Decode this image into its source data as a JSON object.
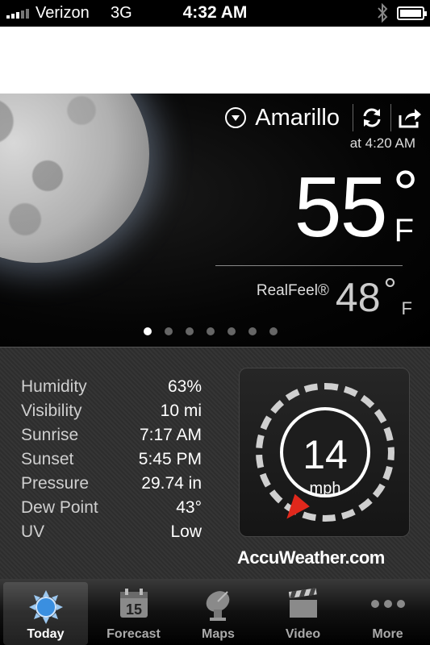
{
  "status_bar": {
    "carrier": "Verizon",
    "network": "3G",
    "time": "4:32 AM",
    "battery_level": 0.9
  },
  "current": {
    "city": "Amarillo",
    "observed_at": "at 4:20 AM",
    "temperature": "55",
    "temp_degree": "°",
    "temp_unit": "F",
    "realfeel_label": "RealFeel®",
    "realfeel_value": "48",
    "realfeel_degree": "°",
    "realfeel_unit": "F",
    "page_count": 7,
    "active_page": 1
  },
  "details": {
    "stats": [
      {
        "label": "Humidity",
        "value": "63%"
      },
      {
        "label": "Visibility",
        "value": "10 mi"
      },
      {
        "label": "Sunrise",
        "value": "7:17 AM"
      },
      {
        "label": "Sunset",
        "value": "5:45 PM"
      },
      {
        "label": "Pressure",
        "value": "29.74 in"
      },
      {
        "label": "Dew Point",
        "value": "43°"
      },
      {
        "label": "UV",
        "value": "Low"
      }
    ],
    "wind_speed": "14",
    "wind_unit": "mph",
    "brand": "AccuWeather.com"
  },
  "tabs": [
    {
      "label": "Today",
      "icon": "sun-icon",
      "active": true
    },
    {
      "label": "Forecast",
      "icon": "calendar-icon",
      "day": "15"
    },
    {
      "label": "Maps",
      "icon": "satellite-dish-icon"
    },
    {
      "label": "Video",
      "icon": "clapperboard-icon"
    },
    {
      "label": "More",
      "icon": "more-dots-icon"
    }
  ],
  "colors": {
    "wind_arrow": "#e0281c",
    "active_tab_icon": "#3a8fe0"
  }
}
